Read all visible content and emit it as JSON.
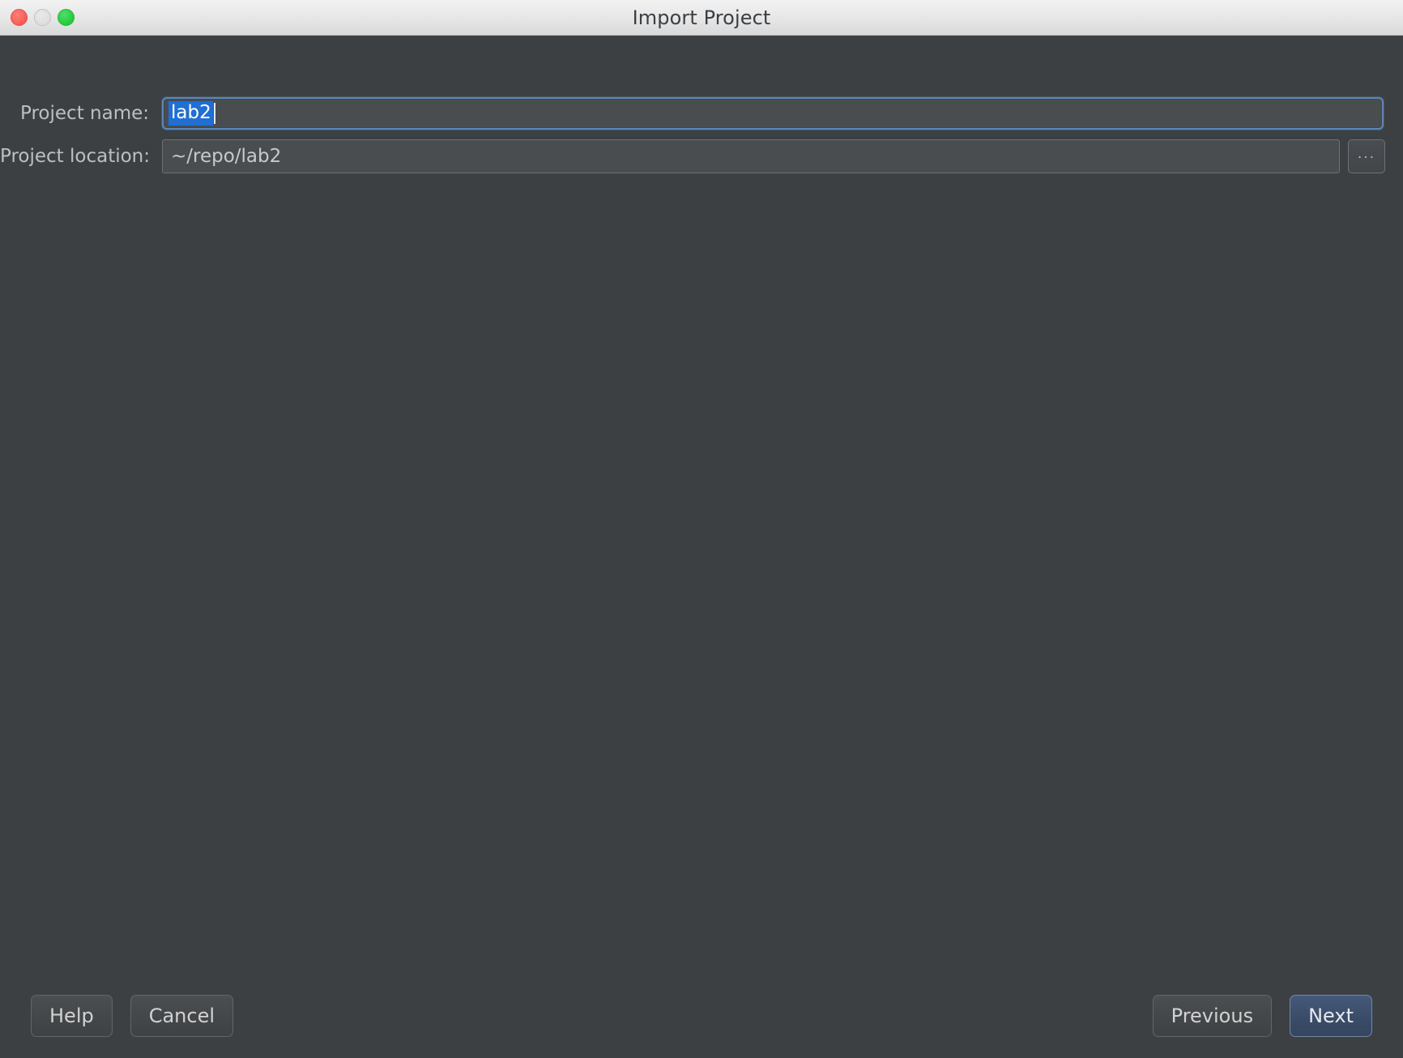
{
  "window": {
    "title": "Import Project",
    "traffic_lights": [
      {
        "name": "close",
        "color": "#fc5d54"
      },
      {
        "name": "minimize",
        "color": "#dedede"
      },
      {
        "name": "maximize",
        "color": "#27c93f"
      }
    ],
    "background_color": "#3c4043"
  },
  "form": {
    "project_name": {
      "label": "Project name:",
      "value": "lab2",
      "selected": true,
      "focused": true,
      "selection_color": "#1f6fd4",
      "focus_border_color": "#5a87b6"
    },
    "project_location": {
      "label": "Project location:",
      "value": "~/repo/lab2",
      "browse_label": "..."
    }
  },
  "footer": {
    "help_label": "Help",
    "cancel_label": "Cancel",
    "previous_label": "Previous",
    "next_label": "Next",
    "default_button": "Next",
    "default_button_color": "#3b4c69"
  }
}
